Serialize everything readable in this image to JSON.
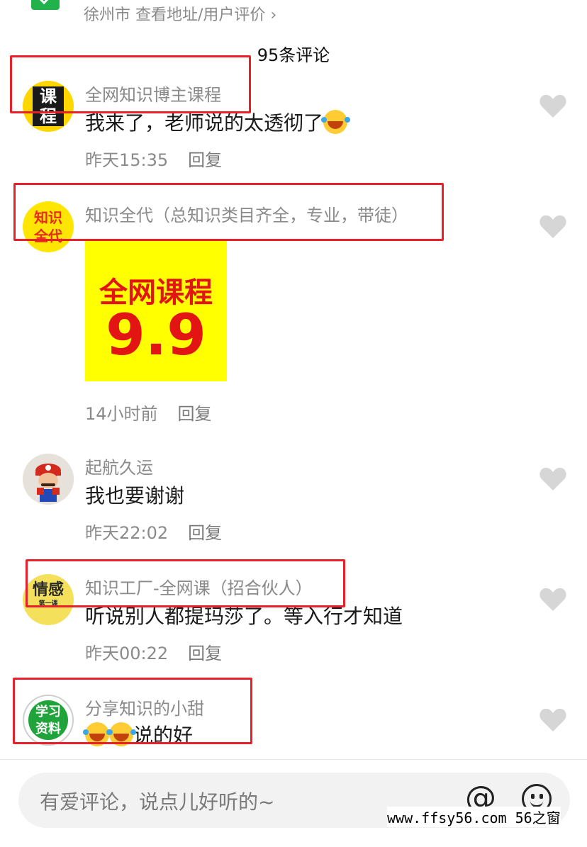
{
  "location": {
    "city": "徐州市",
    "link": "查看地址/用户评价",
    "chevron": "›"
  },
  "comment_count": "95条评论",
  "comments": [
    {
      "author": "全网知识博主课程",
      "text": "我来了，老师说的太透彻了",
      "time": "昨天15:35",
      "reply": "回复",
      "avatar_text": "课\n程",
      "emoji": "rofl-emoji"
    },
    {
      "author": "知识全代（总知识类目齐全，专业，带徒）",
      "time": "14小时前",
      "reply": "回复",
      "avatar_text": "知识\n全代",
      "image": {
        "line1": "全网课程",
        "line2": "9.9"
      }
    },
    {
      "author": "起航久运",
      "text": "我也要谢谢",
      "time": "昨天22:02",
      "reply": "回复"
    },
    {
      "author": "知识工厂-全网课（招合伙人）",
      "text": "听说别人都提玛莎了。等入行才知道",
      "time": "昨天00:22",
      "reply": "回复",
      "avatar_text": "情感",
      "avatar_sub": "第一课"
    },
    {
      "author": "分享知识的小甜",
      "text": "说的好",
      "avatar_text": "学习\n资料"
    }
  ],
  "input": {
    "placeholder": "有爱评论，说点儿好听的~",
    "at_symbol": "@"
  },
  "watermark": "www.ffsy56.com 56之窗",
  "colors": {
    "highlight_box": "#e8202a",
    "promo_bg": "#ffff00",
    "promo_text": "#e31414"
  }
}
